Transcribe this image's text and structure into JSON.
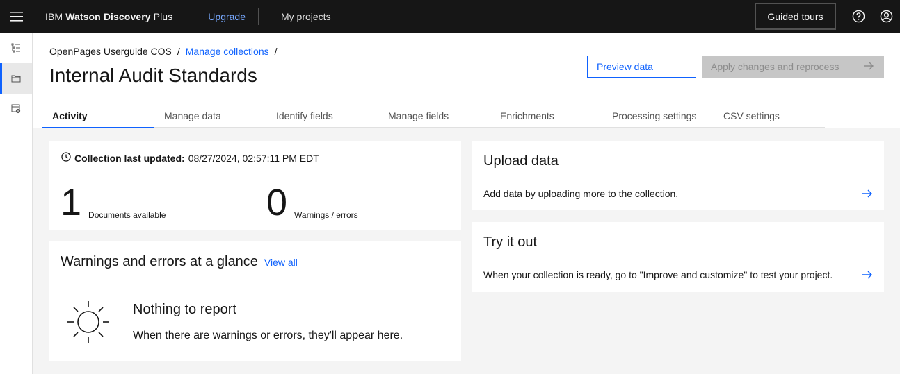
{
  "header": {
    "brand_prefix": "IBM",
    "brand_name": "Watson Discovery",
    "brand_suffix": "Plus",
    "upgrade": "Upgrade",
    "my_projects": "My projects",
    "guided_tours": "Guided tours"
  },
  "breadcrumb": {
    "project": "OpenPages Userguide COS",
    "separator": "/",
    "collections": "Manage collections",
    "trailing": "/"
  },
  "page": {
    "title": "Internal Audit Standards",
    "preview_button": "Preview data",
    "apply_button": "Apply changes and reprocess"
  },
  "tabs": [
    {
      "label": "Activity",
      "active": true
    },
    {
      "label": "Manage data"
    },
    {
      "label": "Identify fields"
    },
    {
      "label": "Manage fields"
    },
    {
      "label": "Enrichments"
    },
    {
      "label": "Processing settings"
    },
    {
      "label": "CSV settings"
    }
  ],
  "activity": {
    "last_updated_label": "Collection last updated:",
    "last_updated_value": "08/27/2024, 02:57:11 PM EDT",
    "documents_count": "1",
    "documents_label": "Documents available",
    "warnings_count": "0",
    "warnings_label": "Warnings / errors"
  },
  "warnings_card": {
    "title": "Warnings and errors at a glance",
    "view_all": "View all",
    "empty_title": "Nothing to report",
    "empty_text": "When there are warnings or errors, they'll appear here."
  },
  "upload_card": {
    "title": "Upload data",
    "text": "Add data by uploading more to the collection."
  },
  "try_card": {
    "title": "Try it out",
    "text": "When your collection is ready, go to \"Improve and customize\" to test your project."
  },
  "icons": {
    "menu": "hamburger-menu-icon",
    "help": "help-icon",
    "user": "user-avatar-icon",
    "side_1": "tree-view-icon",
    "side_2": "folder-icon",
    "side_3": "data-settings-icon",
    "clock": "clock-icon",
    "sun": "sun-icon",
    "arrow": "arrow-right-icon"
  },
  "colors": {
    "header_bg": "#161616",
    "link": "#0f62fe",
    "upgrade_link": "#78a9ff",
    "disabled_bg": "#c6c6c6"
  }
}
